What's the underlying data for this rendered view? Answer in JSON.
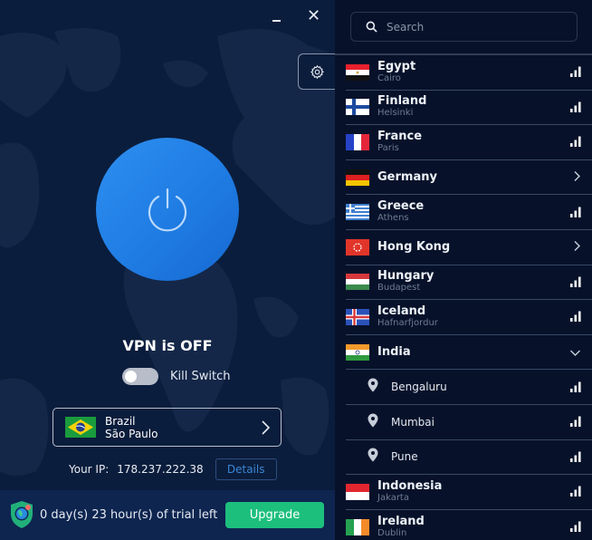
{
  "window": {
    "minimize_icon": "minimize-icon",
    "close_icon": "close-icon",
    "close_glyph": "✕"
  },
  "main": {
    "settings_icon": "gear-icon",
    "power_icon": "power-icon",
    "status": "VPN is OFF",
    "kill_switch": {
      "label": "Kill Switch",
      "enabled": false
    },
    "location": {
      "country": "Brazil",
      "city": "São Paulo",
      "flag": "brazil-flag"
    },
    "ip": {
      "label": "Your IP:",
      "value": "178.237.222.38",
      "details_label": "Details"
    },
    "trial": {
      "text": "0 day(s) 23 hour(s) of trial left",
      "upgrade_label": "Upgrade"
    }
  },
  "colors": {
    "accent_blue": "#2e8ff0",
    "upgrade_green": "#1dbf7d",
    "left_bg": "#0b1d3c",
    "right_bg": "#07122a"
  },
  "search": {
    "placeholder": "Search",
    "value": ""
  },
  "servers": [
    {
      "country": "Egypt",
      "city": "Cairo",
      "flag": "egypt",
      "action": "signal"
    },
    {
      "country": "Finland",
      "city": "Helsinki",
      "flag": "finland",
      "action": "signal"
    },
    {
      "country": "France",
      "city": "Paris",
      "flag": "france",
      "action": "signal"
    },
    {
      "country": "Germany",
      "city": "",
      "flag": "germany",
      "action": "expand"
    },
    {
      "country": "Greece",
      "city": "Athens",
      "flag": "greece",
      "action": "signal"
    },
    {
      "country": "Hong Kong",
      "city": "",
      "flag": "hongkong",
      "action": "expand"
    },
    {
      "country": "Hungary",
      "city": "Budapest",
      "flag": "hungary",
      "action": "signal"
    },
    {
      "country": "Iceland",
      "city": "Hafnarfjordur",
      "flag": "iceland",
      "action": "signal"
    },
    {
      "country": "India",
      "city": "",
      "flag": "india",
      "action": "collapse"
    },
    {
      "sub": true,
      "city": "Bengaluru",
      "action": "signal"
    },
    {
      "sub": true,
      "city": "Mumbai",
      "action": "signal"
    },
    {
      "sub": true,
      "city": "Pune",
      "action": "signal"
    },
    {
      "country": "Indonesia",
      "city": "Jakarta",
      "flag": "indonesia",
      "action": "signal"
    },
    {
      "country": "Ireland",
      "city": "Dublin",
      "flag": "ireland",
      "action": "signal"
    }
  ]
}
